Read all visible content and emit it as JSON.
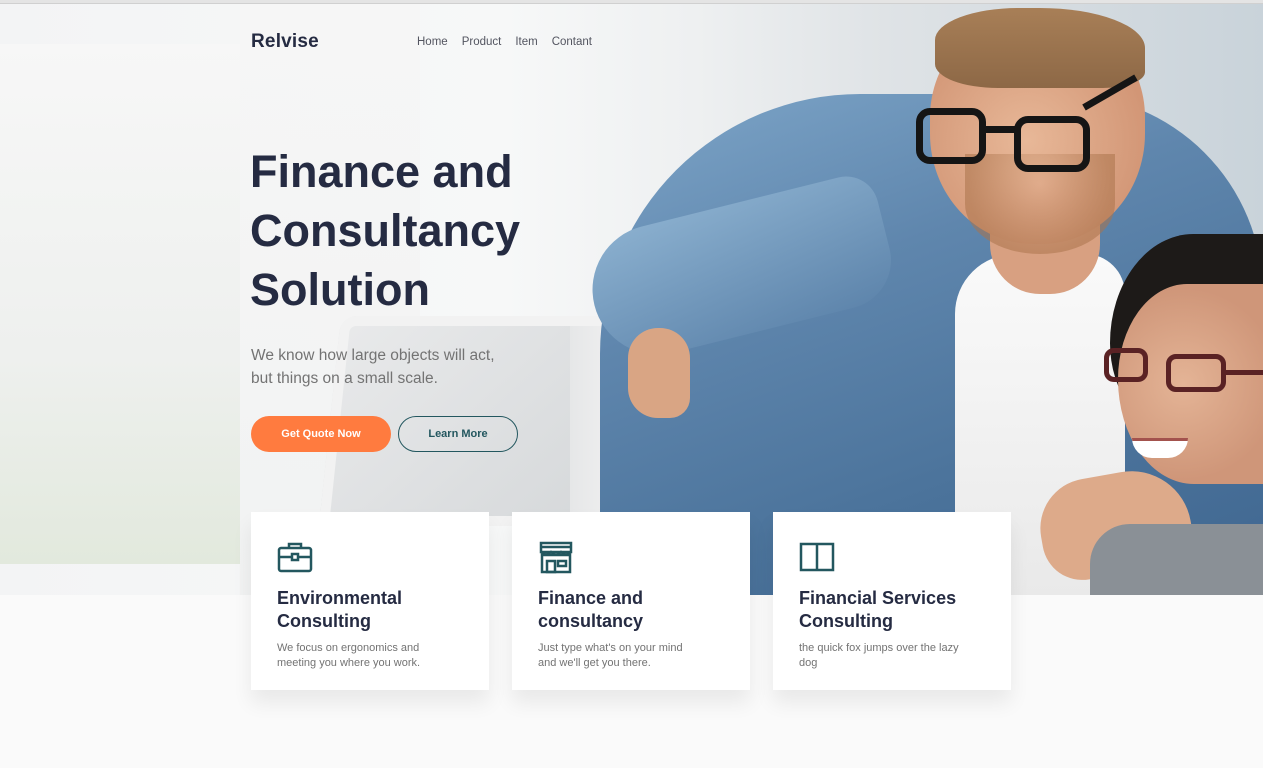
{
  "brand": "Relvise",
  "nav": {
    "home": "Home",
    "product": "Product",
    "item": "Item",
    "contact": "Contant"
  },
  "hero": {
    "title_line1": "Finance and",
    "title_line2": "Consultancy",
    "title_line3": "Solution",
    "desc_line1": "We know how large objects will act,",
    "desc_line2": "but things on a small scale.",
    "primary_button": "Get Quote Now",
    "secondary_button": "Learn More"
  },
  "cards": [
    {
      "icon": "briefcase-icon",
      "title_line1": "Environmental",
      "title_line2": "Consulting",
      "text_line1": "We focus on ergonomics and",
      "text_line2": "meeting you where you work."
    },
    {
      "icon": "store-icon",
      "title_line1": "Finance and",
      "title_line2": "consultancy",
      "text_line1": "Just type what's on your mind",
      "text_line2": "and we'll get you there."
    },
    {
      "icon": "book-icon",
      "title_line1": "Financial Services",
      "title_line2": "Consulting",
      "text_line1": "the quick fox jumps over the lazy",
      "text_line2": "dog"
    }
  ],
  "colors": {
    "primary": "#ff7b3f",
    "accent": "#23575f",
    "heading": "#252b42",
    "text": "#737373"
  }
}
